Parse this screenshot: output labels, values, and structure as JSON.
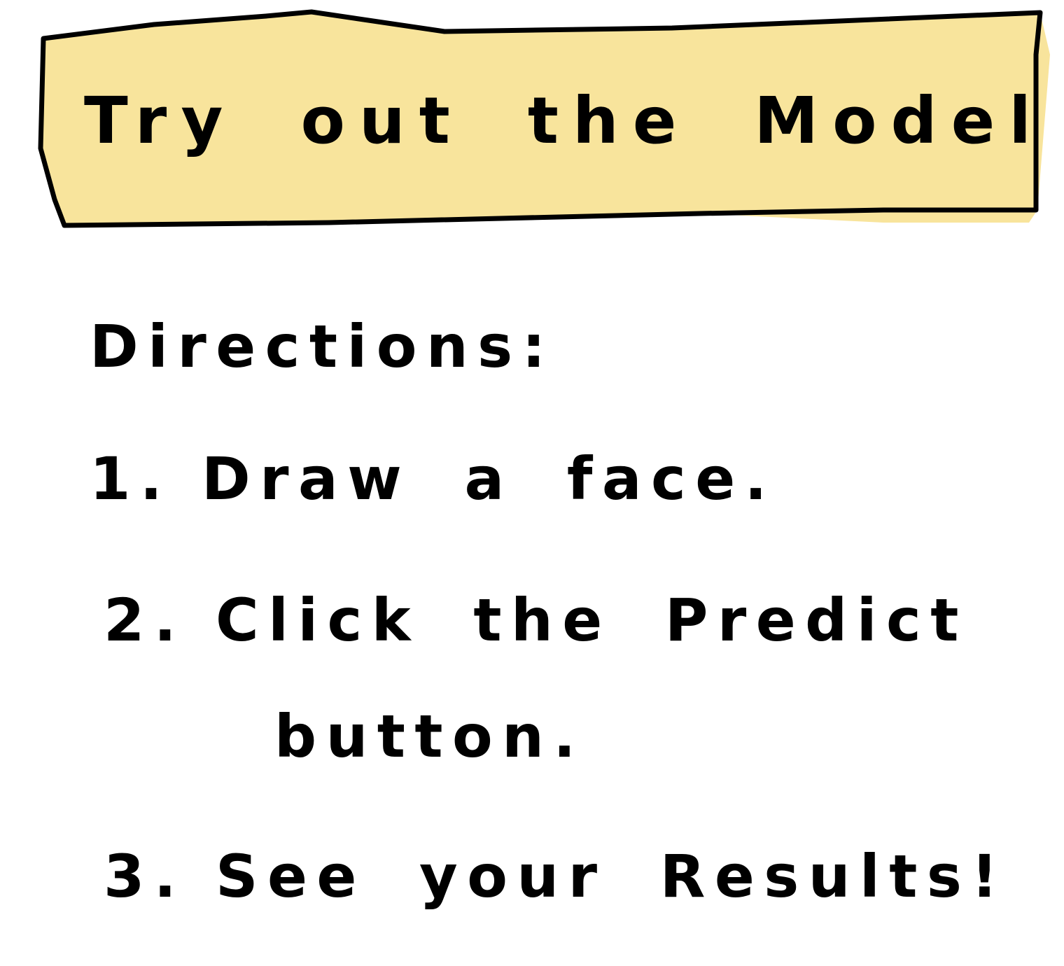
{
  "colors": {
    "header_fill": "#F8E49C",
    "ink": "#000000",
    "background": "#FFFFFF"
  },
  "header": {
    "title": "Try out the Model"
  },
  "directions": {
    "heading": "Directions:",
    "steps": [
      {
        "number": "1.",
        "text": "Draw a face."
      },
      {
        "number": "2.",
        "text": "Click the Predict",
        "continuation": "button."
      },
      {
        "number": "3.",
        "text": "See your Results!"
      }
    ]
  }
}
